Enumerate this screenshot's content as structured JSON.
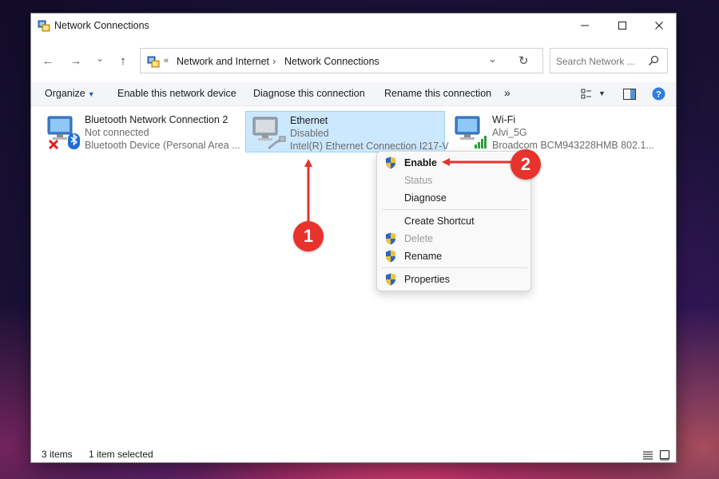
{
  "window": {
    "title": "Network Connections",
    "controls": {
      "minimize": "—",
      "maximize": "☐",
      "close": "✕"
    }
  },
  "address": {
    "back": "←",
    "forward": "→",
    "recent": "⌄",
    "up": "↑",
    "overflow": "«",
    "crumbs": [
      "Network and Internet",
      "Network Connections"
    ],
    "crumb_sep": "›",
    "dropdown": "⌄",
    "refresh": "↻"
  },
  "search": {
    "placeholder": "Search Network ..."
  },
  "toolbar": {
    "organize": "Organize",
    "enable_device": "Enable this network device",
    "diagnose": "Diagnose this connection",
    "rename": "Rename this connection",
    "more": "»"
  },
  "connections": [
    {
      "name": "Bluetooth Network Connection 2",
      "status": "Not connected",
      "device": "Bluetooth Device (Personal Area ..."
    },
    {
      "name": "Ethernet",
      "status": "Disabled",
      "device": "Intel(R) Ethernet Connection I217-V"
    },
    {
      "name": "Wi-Fi",
      "status": "Alvi_5G",
      "device": "Broadcom BCM943228HMB 802.1..."
    }
  ],
  "context_menu": {
    "enable": "Enable",
    "status": "Status",
    "diagnose": "Diagnose",
    "create_shortcut": "Create Shortcut",
    "delete": "Delete",
    "rename": "Rename",
    "properties": "Properties"
  },
  "statusbar": {
    "items_count": "3 items",
    "selected": "1 item selected"
  },
  "annotations": {
    "badge1": "1",
    "badge2": "2",
    "color": "#e8322d"
  }
}
